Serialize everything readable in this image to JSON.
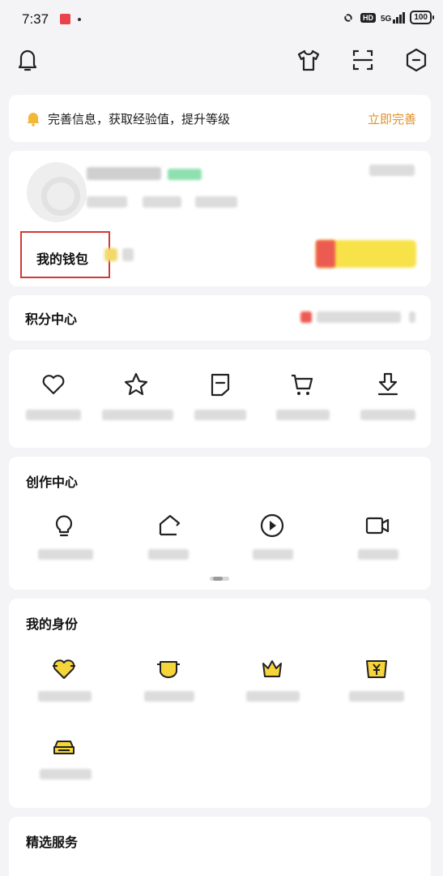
{
  "status_bar": {
    "time": "7:37",
    "network": "5G",
    "hd": "HD",
    "battery": "100"
  },
  "top_bar": {
    "icons": [
      "bell-icon",
      "tshirt-icon",
      "scan-icon",
      "settings-hexagon-icon"
    ]
  },
  "banner": {
    "text": "完善信息，获取经验值，提升等级",
    "link": "立即完善",
    "icon": "bell-icon",
    "link_color": "#e0922a"
  },
  "profile": {
    "wallet_label": "我的钱包",
    "highlight_color": "#d43838"
  },
  "points": {
    "title": "积分中心"
  },
  "quick_actions": {
    "icons": [
      "heart-icon",
      "star-icon",
      "note-icon",
      "cart-icon",
      "download-icon"
    ]
  },
  "create_center": {
    "title": "创作中心",
    "icons": [
      "lightbulb-icon",
      "pen-house-icon",
      "play-circle-icon",
      "video-camera-icon"
    ]
  },
  "identity": {
    "title": "我的身份",
    "icons": [
      "heart-badge-icon",
      "shield-badge-icon",
      "crown-badge-icon",
      "yen-badge-icon",
      "car-badge-icon"
    ],
    "accent_color": "#f5d53a"
  },
  "services": {
    "title": "精选服务"
  }
}
